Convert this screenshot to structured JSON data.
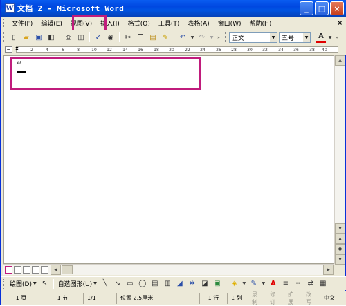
{
  "window": {
    "title": "文档 2 - Microsoft Word",
    "buttons": {
      "minimize": "_",
      "maximize": "□",
      "close": "×"
    }
  },
  "menu": {
    "items": [
      {
        "label": "文件(F)"
      },
      {
        "label": "编辑(E)"
      },
      {
        "label": "视图(V)"
      },
      {
        "label": "插入(I)"
      },
      {
        "label": "格式(O)"
      },
      {
        "label": "工具(T)"
      },
      {
        "label": "表格(A)"
      },
      {
        "label": "窗口(W)"
      },
      {
        "label": "帮助(H)"
      }
    ],
    "close_doc": "×"
  },
  "toolbar": {
    "style": "正文",
    "font_size": "五号",
    "font_color_label": "A"
  },
  "ruler": {
    "ticks": [
      "2",
      "4",
      "6",
      "8",
      "10",
      "12",
      "14",
      "16",
      "18",
      "20",
      "22",
      "24",
      "26",
      "28",
      "30",
      "32",
      "34",
      "36",
      "38",
      "40"
    ]
  },
  "drawbar": {
    "draw_label": "绘图(D)",
    "autoshapes_label": "自选图形(U)"
  },
  "status": {
    "page": "1 页",
    "section": "1 节",
    "pages": "1/1",
    "position": "位置 2.5厘米",
    "line": "1 行",
    "column": "1 列",
    "rec": "录制",
    "trk": "修订",
    "ext": "扩展",
    "ovr": "改写",
    "lang": "中文"
  },
  "colors": {
    "highlight": "#c01c7c",
    "titlebar": "#0054e3"
  }
}
